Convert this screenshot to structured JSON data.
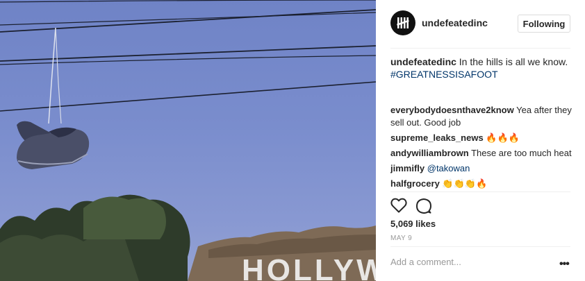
{
  "header": {
    "username": "undefeatedinc",
    "follow_label": "Following"
  },
  "caption": {
    "username": "undefeatedinc",
    "text": " In the hills is all we know.",
    "hashtag": "#GREATNESSISAFOOT"
  },
  "comments": [
    {
      "username": "everybodydoesnthave2know",
      "text": " Yea after they sell out. Good job"
    },
    {
      "username": "supreme_leaks_news",
      "text": " 🔥🔥🔥"
    },
    {
      "username": "andywilliambrown",
      "text": " These are too much heat"
    },
    {
      "username": "jimmifly",
      "text": " ",
      "mention": "@takowan"
    },
    {
      "username": "halfgrocery",
      "text": " 👏👏👏🔥"
    }
  ],
  "photo": {
    "sign_text": "HOLLYW"
  },
  "actions": {
    "like_icon": "heart-icon",
    "comment_icon": "comment-icon"
  },
  "likes": "5,069 likes",
  "date": "MAY 9",
  "add_comment_placeholder": "Add a comment...",
  "more_label": "•••"
}
